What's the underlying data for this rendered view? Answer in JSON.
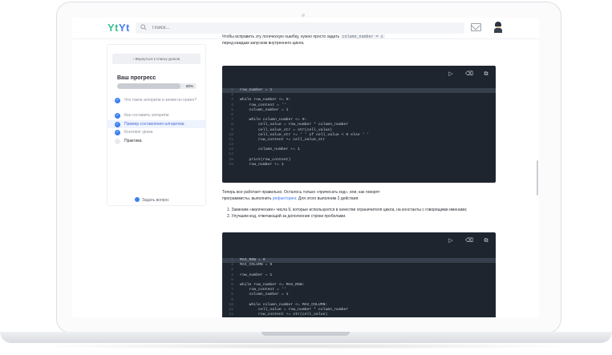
{
  "header": {
    "logo_part1": "Yt",
    "logo_part2": "Yt",
    "search_placeholder": "Поиск..."
  },
  "sidebar": {
    "back_label": "Вернуться к списку уроков",
    "progress_title": "Ваш прогресс",
    "progress_label": "80%",
    "progress_value": 0.8,
    "items": [
      {
        "label": "Что такое алгоритм и зачем он нужен?",
        "done": true
      },
      {
        "label": "Как составить алгоритм",
        "done": true
      },
      {
        "label": "Пример составления алгоритма",
        "done": true,
        "active": true
      },
      {
        "label": "Конспект урока",
        "done": true
      },
      {
        "label": "Практика",
        "done": false
      }
    ],
    "ask_label": "Задать вопрос"
  },
  "content": {
    "intro_text_1": "Чтобы исправить эту логическую ошибку, нужно просто задать",
    "intro_code": "column_number = 1",
    "intro_text_2": "перед каждым запуском внутреннего цикла.",
    "code_block_1": [
      {
        "n": "1",
        "t": "row_number = 1"
      },
      {
        "n": "2",
        "t": ""
      },
      {
        "n": "3",
        "t": "while row_number <= 9:"
      },
      {
        "n": "4",
        "t": "    row_content = ''"
      },
      {
        "n": "5",
        "t": "    column_number = 1"
      },
      {
        "n": "6",
        "t": ""
      },
      {
        "n": "7",
        "t": "    while column_number <= 9:"
      },
      {
        "n": "8",
        "t": "        cell_value = row_number * column_number"
      },
      {
        "n": "9",
        "t": "        cell_value_str = str(cell_value)"
      },
      {
        "n": "10",
        "t": "        cell_value_str += ' ' if cell_value < 9 else ' '"
      },
      {
        "n": "11",
        "t": "        row_content += cell_value_str"
      },
      {
        "n": "12",
        "t": ""
      },
      {
        "n": "13",
        "t": "        column_number += 1"
      },
      {
        "n": "14",
        "t": ""
      },
      {
        "n": "15",
        "t": "    print(row_content)"
      },
      {
        "n": "16",
        "t": "    row_number += 1"
      }
    ],
    "mid_text_1": "Теперь все работает правильно. Осталось только «причесать код», или, как говорят",
    "mid_text_2a": "программисты, выполнить",
    "mid_link": "рефакторинг",
    "mid_text_2b": ". Для этого выполним 2 действия:",
    "list": [
      "1. Заменим «магические» числа 9, которые используются в качестве ограничителя цикла, на константы с говорящими именами;",
      "2. Улучшим код, отвечающий за дополнение строки пробелами."
    ],
    "code_block_2": [
      {
        "n": "1",
        "t": "MAX_ROW = 9"
      },
      {
        "n": "2",
        "t": "MAX_COLUMN = 9"
      },
      {
        "n": "3",
        "t": ""
      },
      {
        "n": "4",
        "t": "row_number = 1"
      },
      {
        "n": "5",
        "t": ""
      },
      {
        "n": "6",
        "t": "while row_number <= MAX_ROW:"
      },
      {
        "n": "7",
        "t": "    row_content = ''"
      },
      {
        "n": "8",
        "t": "    column_number = 1"
      },
      {
        "n": "9",
        "t": ""
      },
      {
        "n": "10",
        "t": "    while column_number <= MAX_COLUMN:"
      },
      {
        "n": "11",
        "t": "        cell_value = row_number * column_number"
      },
      {
        "n": "12",
        "t": "        row_content += str(cell_value)"
      }
    ],
    "tool_icons": [
      "play-icon",
      "eraser-icon",
      "copy-icon"
    ]
  }
}
